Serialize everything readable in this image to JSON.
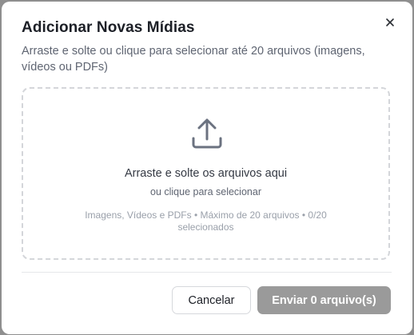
{
  "dialog": {
    "title": "Adicionar Novas Mídias",
    "subtitle": "Arraste e solte ou clique para selecionar até 20 arquivos (imagens, vídeos ou PDFs)",
    "close_icon": "close-icon"
  },
  "dropzone": {
    "icon": "upload-icon",
    "title": "Arraste e solte os arquivos aqui",
    "subtitle": "ou clique para selecionar",
    "info": "Imagens, Vídeos e PDFs • Máximo de 20 arquivos • 0/20 selecionados"
  },
  "footer": {
    "cancel_label": "Cancelar",
    "send_label": "Enviar 0 arquivo(s)"
  },
  "colors": {
    "backdrop": "#8f8f8f",
    "send_button_disabled": "#9a9a9a",
    "dropzone_border": "#d4d6da"
  }
}
